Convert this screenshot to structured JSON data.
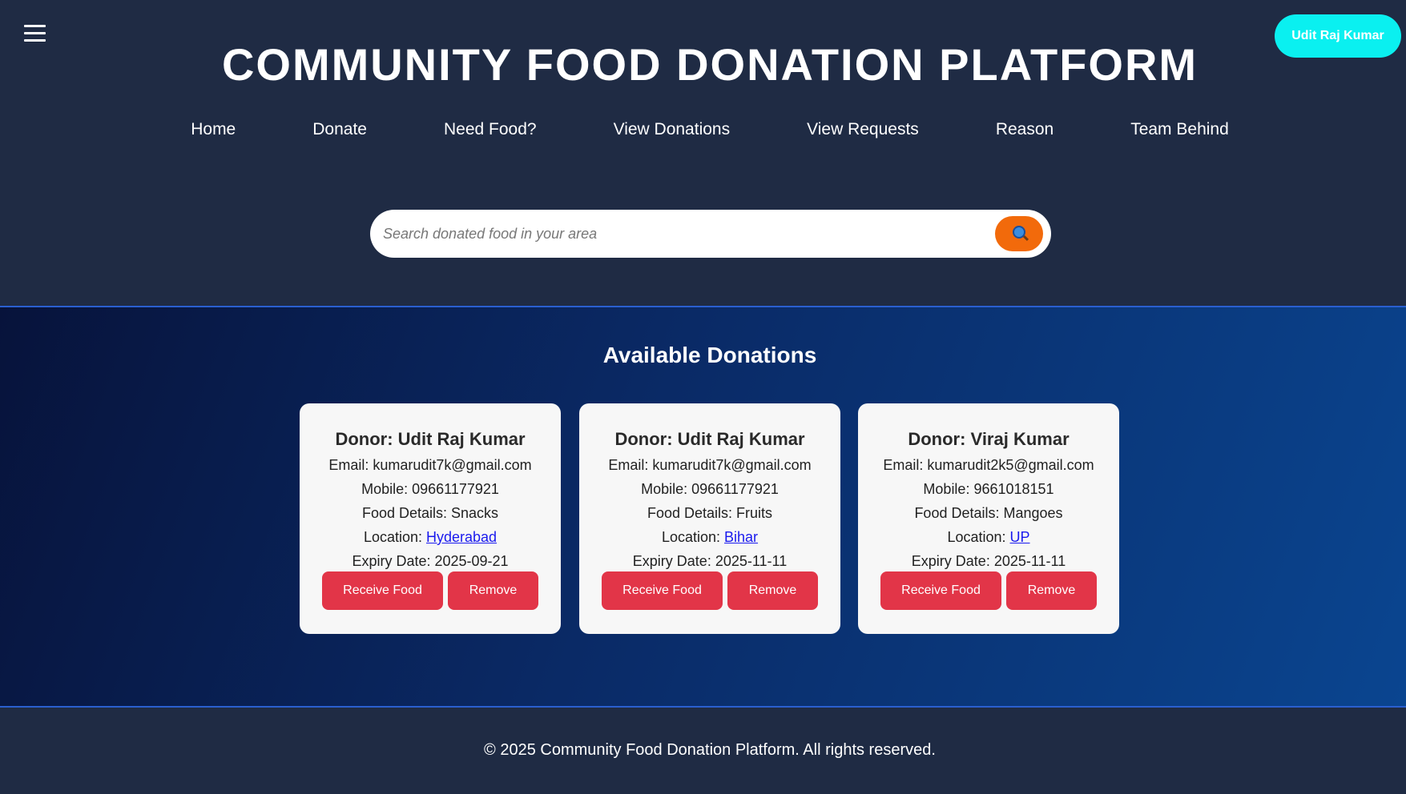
{
  "header": {
    "title": "COMMUNITY FOOD DONATION PLATFORM",
    "user_button": "Udit Raj Kumar",
    "menu_icon": "hamburger-menu-icon"
  },
  "nav": {
    "items": [
      "Home",
      "Donate",
      "Need Food?",
      "View Donations",
      "View Requests",
      "Reason",
      "Team Behind"
    ]
  },
  "search": {
    "placeholder": "Search donated food in your area",
    "value": "",
    "icon": "magnifier-icon"
  },
  "main": {
    "section_title": "Available Donations",
    "cards": [
      {
        "donor": "Donor: Udit Raj Kumar",
        "email": "Email: kumarudit7k@gmail.com",
        "mobile": "Mobile: 09661177921",
        "food": "Food Details: Snacks",
        "location_label": "Location: ",
        "location": "Hyderabad",
        "expiry": "Expiry Date: 2025-09-21",
        "receive_label": "Receive Food",
        "remove_label": "Remove"
      },
      {
        "donor": "Donor: Udit Raj Kumar",
        "email": "Email: kumarudit7k@gmail.com",
        "mobile": "Mobile: 09661177921",
        "food": "Food Details: Fruits",
        "location_label": "Location: ",
        "location": "Bihar",
        "expiry": "Expiry Date: 2025-11-11",
        "receive_label": "Receive Food",
        "remove_label": "Remove"
      },
      {
        "donor": "Donor: Viraj Kumar",
        "email": "Email: kumarudit2k5@gmail.com",
        "mobile": "Mobile: 9661018151",
        "food": "Food Details: Mangoes",
        "location_label": "Location: ",
        "location": "UP",
        "expiry": "Expiry Date: 2025-11-11",
        "receive_label": "Receive Food",
        "remove_label": "Remove"
      }
    ]
  },
  "footer": {
    "text": "© 2025 Community Food Donation Platform. All rights reserved."
  },
  "colors": {
    "header_bg": "#1f2b44",
    "user_button": "#0af0f0",
    "search_button": "#f26a0b",
    "action_button": "#e23548",
    "link": "#1a1aee"
  }
}
